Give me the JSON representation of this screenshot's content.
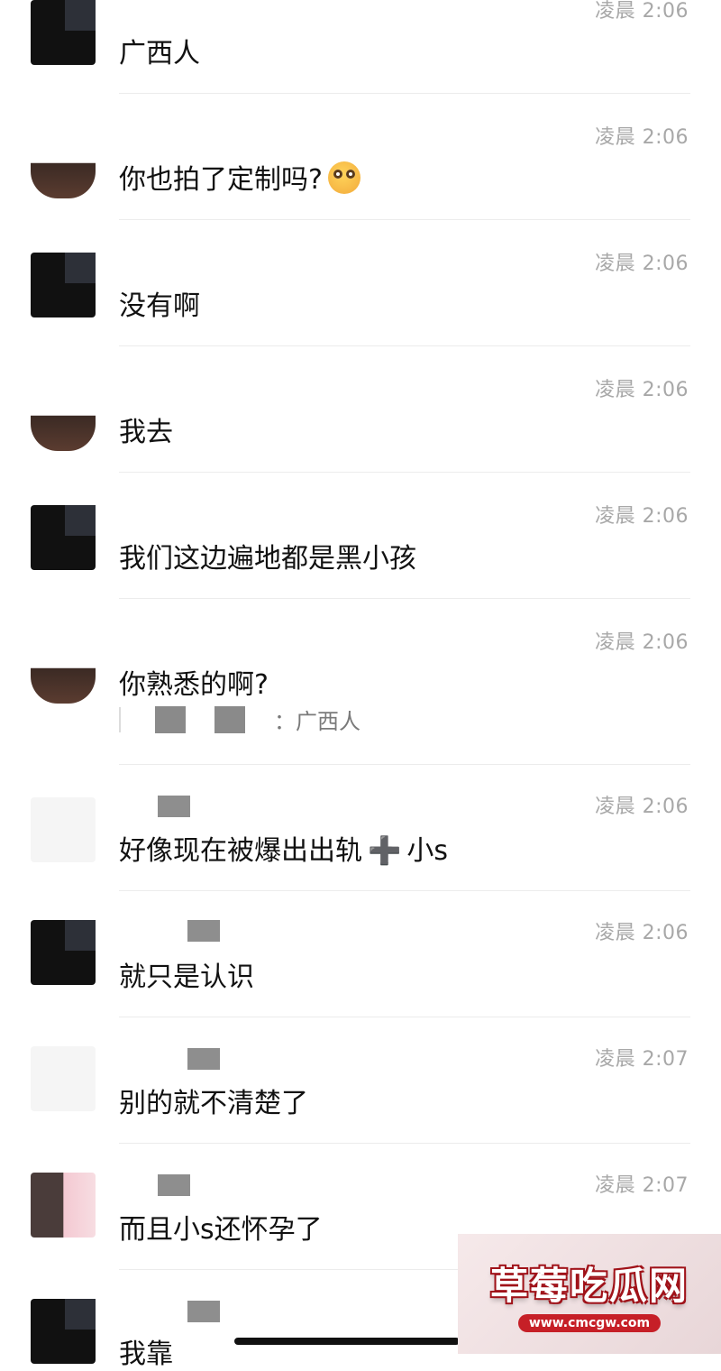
{
  "messages": [
    {
      "time": "凌晨 2:06",
      "text": "广西人",
      "avatar": "dark"
    },
    {
      "time": "凌晨 2:06",
      "text": "你也拍了定制吗?",
      "emoji": "flushed-face-emoji",
      "avatar": "brown"
    },
    {
      "time": "凌晨 2:06",
      "text": "没有啊",
      "avatar": "dark"
    },
    {
      "time": "凌晨 2:06",
      "text": "我去",
      "avatar": "brown"
    },
    {
      "time": "凌晨 2:06",
      "text": "我们这边遍地都是黑小孩",
      "avatar": "dark"
    },
    {
      "time": "凌晨 2:06",
      "text": "你熟悉的啊?",
      "quote": "：广西人",
      "avatar": "brown"
    },
    {
      "time": "凌晨 2:06",
      "text_a": "好像现在被爆出出轨",
      "plus": "➕",
      "text_b": "小s",
      "avatar": "light"
    },
    {
      "time": "凌晨 2:06",
      "text": "就只是认识",
      "avatar": "dark"
    },
    {
      "time": "凌晨 2:07",
      "text": "别的就不清楚了",
      "avatar": "light"
    },
    {
      "time": "凌晨 2:07",
      "text": "而且小s还怀孕了",
      "avatar": "pink"
    },
    {
      "text": "我靠",
      "avatar": "dark"
    }
  ],
  "watermark": {
    "title": "草莓吃瓜网",
    "url": "www.cmcgw.com"
  },
  "colors": {
    "time": "#a8a8a8",
    "divider": "#ececec",
    "watermark_red": "#c61f27"
  }
}
